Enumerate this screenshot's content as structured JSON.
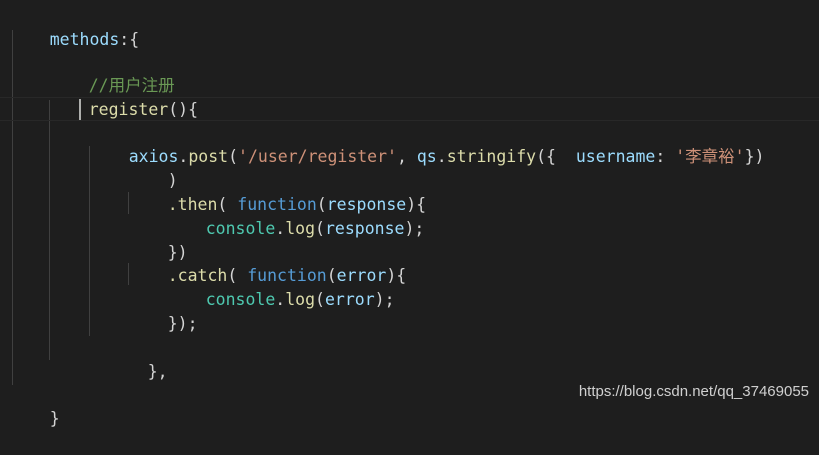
{
  "code": {
    "line1": {
      "ident": "methods",
      "punc": ":{"
    },
    "line3": {
      "comment": "//用户注册"
    },
    "line4": {
      "fn": "register",
      "punc": "(){"
    },
    "line6": {
      "obj": "axios",
      "dot1": ".",
      "method": "post",
      "open": "(",
      "url": "'/user/register'",
      "comma": ", ",
      "qs": "qs",
      "dot2": ".",
      "stringify": "stringify",
      "open2": "({  ",
      "key": "username",
      "colon": ": ",
      "value": "'李章裕'",
      "close": "})"
    },
    "line7": {
      "punc": ")"
    },
    "line8": {
      "method": ".then",
      "open": "( ",
      "kw": "function",
      "open2": "(",
      "param": "response",
      "close": "){"
    },
    "line9": {
      "obj": "console",
      "dot": ".",
      "fn": "log",
      "open": "(",
      "arg": "response",
      "close": ");"
    },
    "line10": {
      "punc": "})"
    },
    "line11": {
      "method": ".catch",
      "open": "( ",
      "kw": "function",
      "open2": "(",
      "param": "error",
      "close": "){"
    },
    "line12": {
      "obj": "console",
      "dot": ".",
      "fn": "log",
      "open": "(",
      "arg": "error",
      "close": ");"
    },
    "line13": {
      "punc": "});"
    },
    "line15": {
      "punc": "},"
    },
    "line17": {
      "punc": "}"
    }
  },
  "watermark": "https://blog.csdn.net/qq_37469055",
  "colors": {
    "background": "#1e1e1e",
    "variable": "#9cdcfe",
    "function": "#dcdcaa",
    "string": "#ce9178",
    "keyword": "#569cd6",
    "comment": "#6a9955",
    "class": "#4ec9b0"
  }
}
